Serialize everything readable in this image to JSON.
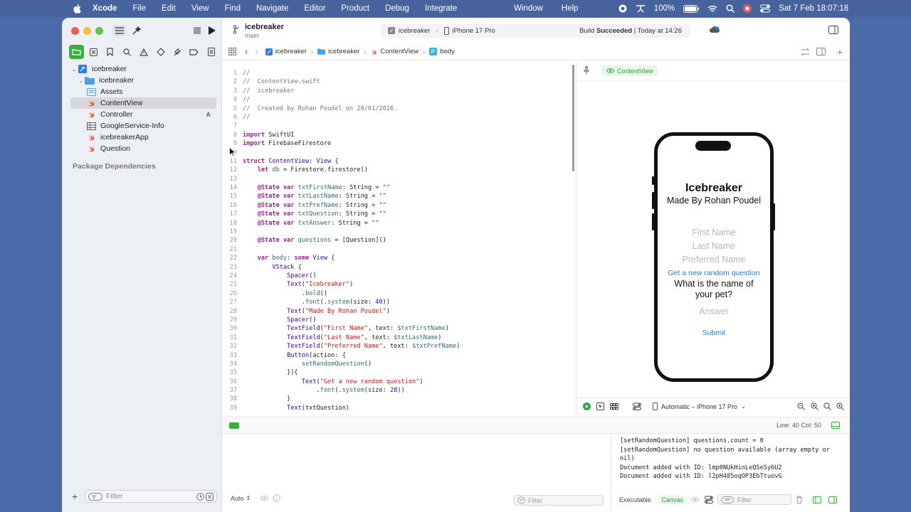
{
  "menubar": {
    "app_name": "Xcode",
    "menus": [
      "File",
      "Edit",
      "View",
      "Find",
      "Navigate",
      "Editor",
      "Product",
      "Debug",
      "Integrate"
    ],
    "mid_menus": [
      "Window",
      "Help"
    ],
    "battery": "100%",
    "datetime": "Sat 7 Feb  18:07:18"
  },
  "toolbar": {
    "project": "icebreaker",
    "branch": "main",
    "scheme": "icebreaker",
    "device": "iPhone 17 Pro",
    "status_prefix": "Build ",
    "status_bold": "Succeeded",
    "status_time": " | Today at 14:26"
  },
  "navigator": {
    "root": "icebreaker",
    "group": "icebreaker",
    "files": [
      {
        "label": "Assets",
        "icon": "assets-icon"
      },
      {
        "label": "ContentView",
        "icon": "swift-file-icon",
        "selected": true
      },
      {
        "label": "Controller",
        "icon": "swift-file-icon",
        "badge": "A"
      },
      {
        "label": "GoogleService-Info",
        "icon": "plist-icon"
      },
      {
        "label": "icebreakerApp",
        "icon": "swift-file-icon"
      },
      {
        "label": "Question",
        "icon": "swift-file-icon"
      }
    ],
    "package_dependencies": "Package Dependencies",
    "filter_placeholder": "Filter"
  },
  "jumpbar": {
    "items": [
      "icebreaker",
      "icebreaker",
      "ContentView",
      "body"
    ]
  },
  "editor": {
    "lines": [
      [
        [
          "cm",
          "//"
        ]
      ],
      [
        [
          "cm",
          "//  ContentView.swift"
        ]
      ],
      [
        [
          "cm",
          "//  icebreaker"
        ]
      ],
      [
        [
          "cm",
          "//"
        ]
      ],
      [
        [
          "cm",
          "//  Created by Rohan Poudel on 28/01/2026."
        ]
      ],
      [
        [
          "cm",
          "//"
        ]
      ],
      [],
      [
        [
          "kw",
          "import"
        ],
        [
          "tx",
          " SwiftUI"
        ]
      ],
      [
        [
          "kw",
          "import"
        ],
        [
          "tx",
          " FirebaseFirestore"
        ]
      ],
      [],
      [
        [
          "kw",
          "struct"
        ],
        [
          "tx",
          " "
        ],
        [
          "ty",
          "ContentView"
        ],
        [
          "tx",
          ": "
        ],
        [
          "ty",
          "View"
        ],
        [
          "tx",
          " {"
        ]
      ],
      [
        [
          "tx",
          "    "
        ],
        [
          "kw",
          "let"
        ],
        [
          "tx",
          " "
        ],
        [
          "fn",
          "db"
        ],
        [
          "tx",
          " = Firestore.firestore()"
        ]
      ],
      [],
      [
        [
          "tx",
          "    "
        ],
        [
          "kw",
          "@State"
        ],
        [
          "tx",
          " "
        ],
        [
          "kw",
          "var"
        ],
        [
          "tx",
          " "
        ],
        [
          "fn",
          "txtFirstName"
        ],
        [
          "tx",
          ": String = "
        ],
        [
          "st",
          "\"\""
        ]
      ],
      [
        [
          "tx",
          "    "
        ],
        [
          "kw",
          "@State"
        ],
        [
          "tx",
          " "
        ],
        [
          "kw",
          "var"
        ],
        [
          "tx",
          " "
        ],
        [
          "fn",
          "txtLastName"
        ],
        [
          "tx",
          ": String = "
        ],
        [
          "st",
          "\"\""
        ]
      ],
      [
        [
          "tx",
          "    "
        ],
        [
          "kw",
          "@State"
        ],
        [
          "tx",
          " "
        ],
        [
          "kw",
          "var"
        ],
        [
          "tx",
          " "
        ],
        [
          "fn",
          "txtPrefName"
        ],
        [
          "tx",
          ": String = "
        ],
        [
          "st",
          "\"\""
        ]
      ],
      [
        [
          "tx",
          "    "
        ],
        [
          "kw",
          "@State"
        ],
        [
          "tx",
          " "
        ],
        [
          "kw",
          "var"
        ],
        [
          "tx",
          " "
        ],
        [
          "fn",
          "txtQuestion"
        ],
        [
          "tx",
          ": String = "
        ],
        [
          "st",
          "\"\""
        ]
      ],
      [
        [
          "tx",
          "    "
        ],
        [
          "kw",
          "@State"
        ],
        [
          "tx",
          " "
        ],
        [
          "kw",
          "var"
        ],
        [
          "tx",
          " "
        ],
        [
          "fn",
          "txtAnswer"
        ],
        [
          "tx",
          ": String = "
        ],
        [
          "st",
          "\"\""
        ]
      ],
      [],
      [
        [
          "tx",
          "    "
        ],
        [
          "kw",
          "@State"
        ],
        [
          "tx",
          " "
        ],
        [
          "kw",
          "var"
        ],
        [
          "tx",
          " "
        ],
        [
          "fn",
          "questions"
        ],
        [
          "tx",
          " = [Question]()"
        ]
      ],
      [],
      [
        [
          "tx",
          "    "
        ],
        [
          "kw",
          "var"
        ],
        [
          "tx",
          " "
        ],
        [
          "fn",
          "body"
        ],
        [
          "tx",
          ": "
        ],
        [
          "kw",
          "some"
        ],
        [
          "tx",
          " "
        ],
        [
          "ty",
          "View"
        ],
        [
          "tx",
          " {"
        ]
      ],
      [
        [
          "tx",
          "        "
        ],
        [
          "ty",
          "VStack"
        ],
        [
          "tx",
          " {"
        ]
      ],
      [
        [
          "tx",
          "            "
        ],
        [
          "ty",
          "Spacer"
        ],
        [
          "tx",
          "()"
        ]
      ],
      [
        [
          "tx",
          "            "
        ],
        [
          "ty",
          "Text"
        ],
        [
          "tx",
          "("
        ],
        [
          "st",
          "\"Icebreaker\""
        ],
        [
          "tx",
          ")"
        ]
      ],
      [
        [
          "tx",
          "                ."
        ],
        [
          "fn",
          "bold"
        ],
        [
          "tx",
          "()"
        ]
      ],
      [
        [
          "tx",
          "                ."
        ],
        [
          "fn",
          "font"
        ],
        [
          "tx",
          "(."
        ],
        [
          "fn",
          "system"
        ],
        [
          "tx",
          "(size: "
        ],
        [
          "nm",
          "40"
        ],
        [
          "tx",
          "))"
        ]
      ],
      [
        [
          "tx",
          "            "
        ],
        [
          "ty",
          "Text"
        ],
        [
          "tx",
          "("
        ],
        [
          "st",
          "\"Made By Rohan Poudel\""
        ],
        [
          "tx",
          ")"
        ]
      ],
      [
        [
          "tx",
          "            "
        ],
        [
          "ty",
          "Spacer"
        ],
        [
          "tx",
          "()"
        ]
      ],
      [
        [
          "tx",
          "            "
        ],
        [
          "ty",
          "TextField"
        ],
        [
          "tx",
          "("
        ],
        [
          "st",
          "\"First Name\""
        ],
        [
          "tx",
          ", text: "
        ],
        [
          "fn",
          "$txtFirstName"
        ],
        [
          "tx",
          ")"
        ]
      ],
      [
        [
          "tx",
          "            "
        ],
        [
          "ty",
          "TextField"
        ],
        [
          "tx",
          "("
        ],
        [
          "st",
          "\"Last Name\""
        ],
        [
          "tx",
          ", text: "
        ],
        [
          "fn",
          "$txtLastName"
        ],
        [
          "tx",
          ")"
        ]
      ],
      [
        [
          "tx",
          "            "
        ],
        [
          "ty",
          "TextField"
        ],
        [
          "tx",
          "("
        ],
        [
          "st",
          "\"Preferred Name\""
        ],
        [
          "tx",
          ", text: "
        ],
        [
          "fn",
          "$txtPrefName"
        ],
        [
          "tx",
          ")"
        ]
      ],
      [
        [
          "tx",
          "            "
        ],
        [
          "ty",
          "Button"
        ],
        [
          "tx",
          "(action: {"
        ]
      ],
      [
        [
          "tx",
          "                "
        ],
        [
          "fn",
          "setRandomQuestion"
        ],
        [
          "tx",
          "()"
        ]
      ],
      [
        [
          "tx",
          "            }){"
        ]
      ],
      [
        [
          "tx",
          "                "
        ],
        [
          "ty",
          "Text"
        ],
        [
          "tx",
          "("
        ],
        [
          "st",
          "\"Get a new random question\""
        ],
        [
          "tx",
          ")"
        ]
      ],
      [
        [
          "tx",
          "                    ."
        ],
        [
          "fn",
          "font"
        ],
        [
          "tx",
          "(."
        ],
        [
          "fn",
          "system"
        ],
        [
          "tx",
          "(size: "
        ],
        [
          "nm",
          "28"
        ],
        [
          "tx",
          "))"
        ]
      ],
      [
        [
          "tx",
          "            }"
        ]
      ],
      [
        [
          "tx",
          "            "
        ],
        [
          "ty",
          "Text"
        ],
        [
          "tx",
          "(txtQuestion)"
        ]
      ]
    ]
  },
  "preview": {
    "chip": "ContentView",
    "app": {
      "title": "Icebreaker",
      "subtitle": "Made By Rohan Poudel",
      "first_name_placeholder": "First Name",
      "last_name_placeholder": "Last Name",
      "preferred_name_placeholder": "Preferred Name",
      "random_button": "Get a new random question",
      "question": "What is the name of your pet?",
      "answer_placeholder": "Answer",
      "submit": "Submit"
    },
    "device_selector": "Automatic – iPhone 17 Pro"
  },
  "statusline": {
    "position": "Line: 40  Col: 50"
  },
  "debug": {
    "console_lines": [
      "[setRandomQuestion] questions.count = 0",
      "[setRandomQuestion] no question available (array empty or nil)",
      "Document added with ID: lmp0NUkHinLeQSeSy6U2",
      "Document added with ID: l2pH485oqOP3EbTtuovG"
    ],
    "auto_label": "Auto",
    "filter_placeholder": "Filter",
    "executable": "Executable",
    "canvas": "Canvas",
    "console_filter_placeholder": "Filter"
  },
  "colors": {
    "accent_green": "#38b13c",
    "link_blue": "#2b7bd6",
    "menubar": "#46639e"
  }
}
